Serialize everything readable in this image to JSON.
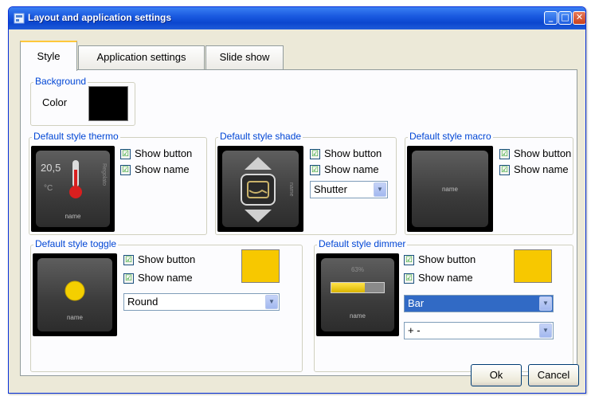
{
  "window": {
    "title": "Layout and application settings",
    "min_glyph": "_",
    "max_glyph": "□",
    "close_glyph": "✕"
  },
  "tabs": [
    {
      "label": "Style",
      "active": true
    },
    {
      "label": "Application settings",
      "active": false
    },
    {
      "label": "Slide show",
      "active": false
    }
  ],
  "background": {
    "title": "Background",
    "color_label": "Color",
    "color": "#000000"
  },
  "thermo": {
    "title": "Default style thermo",
    "temp_value": "20,5",
    "temp_unit": "°C",
    "show_button": "Show button",
    "show_name": "Show name",
    "tile_name": "name",
    "side_label": "Regolato"
  },
  "shade": {
    "title": "Default style shade",
    "show_button": "Show button",
    "show_name": "Show name",
    "type_value": "Shutter",
    "side_label": "name"
  },
  "macro": {
    "title": "Default style macro",
    "show_button": "Show button",
    "show_name": "Show name",
    "tile_name": "name"
  },
  "toggle": {
    "title": "Default style toggle",
    "show_button": "Show button",
    "show_name": "Show name",
    "shape_value": "Round",
    "tile_name": "name",
    "color": "#f7c800"
  },
  "dimmer": {
    "title": "Default style dimmer",
    "show_button": "Show button",
    "show_name": "Show name",
    "style_value": "Bar",
    "buttons_value": "+ -",
    "percent": "63%",
    "level": 0.63,
    "tile_name": "name",
    "color": "#f7c800"
  },
  "checkbox_mark": "☑",
  "footer": {
    "ok": "Ok",
    "cancel": "Cancel"
  },
  "colors": {
    "accent": "#0046d5",
    "title_bar": "#1a5ae0",
    "toggle_yellow": "#f7c800"
  }
}
